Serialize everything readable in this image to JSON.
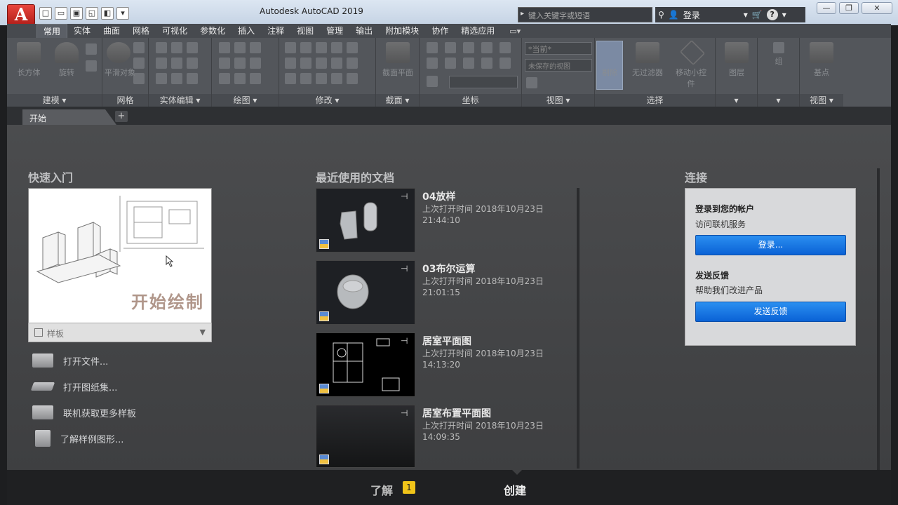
{
  "window": {
    "title": "Autodesk AutoCAD 2019",
    "app_button": "A"
  },
  "search": {
    "placeholder": "键入关键字或短语"
  },
  "topbar": {
    "signin_label": "登录"
  },
  "ribbon_tabs": [
    "常用",
    "实体",
    "曲面",
    "网格",
    "可视化",
    "参数化",
    "插入",
    "注释",
    "视图",
    "管理",
    "输出",
    "附加模块",
    "协作",
    "精选应用"
  ],
  "ribbon_panels": {
    "modeling": {
      "title": "建模",
      "box_label": "长方体",
      "extrude_label": "旋转"
    },
    "mesh": {
      "title": "网格",
      "smooth_label": "平滑对象"
    },
    "solid_edit": {
      "title": "实体编辑"
    },
    "draw": {
      "title": "绘图"
    },
    "modify": {
      "title": "修改"
    },
    "section": {
      "title": "截面",
      "plane_label": "截面平面"
    },
    "coordinates": {
      "title": "坐标"
    },
    "view": {
      "title": "视图",
      "combo1": "*当前*",
      "combo2": "未保存的视图"
    },
    "selection": {
      "title": "选择",
      "culling_label": "剔除",
      "filter_label": "无过滤器",
      "gizmo_label": "移动小控件"
    },
    "layers": {
      "title": "图层"
    },
    "groups": {
      "title": "组"
    },
    "view2": {
      "title": "视图",
      "base_label": "基点"
    }
  },
  "file_tabs": {
    "start": "开始"
  },
  "quick_start": {
    "heading": "快速入门",
    "start_drawing": "开始绘制",
    "template_label": "样板",
    "links": [
      "打开文件...",
      "打开图纸集...",
      "联机获取更多样板",
      "了解样例图形..."
    ]
  },
  "recent": {
    "heading": "最近使用的文档",
    "docs": [
      {
        "name": "04放样",
        "opened": "上次打开时间 2018年10月23日",
        "time": "21:44:10"
      },
      {
        "name": "03布尔运算",
        "opened": "上次打开时间 2018年10月23日",
        "time": "21:01:15"
      },
      {
        "name": "居室平面图",
        "opened": "上次打开时间 2018年10月23日",
        "time": "14:13:20"
      },
      {
        "name": "居室布置平面图",
        "opened": "上次打开时间 2018年10月23日",
        "time": "14:09:35"
      }
    ]
  },
  "connect": {
    "heading": "连接",
    "signin_heading": "登录到您的帐户",
    "signin_sub": "访问联机服务",
    "signin_button": "登录...",
    "feedback_heading": "发送反馈",
    "feedback_sub": "帮助我们改进产品",
    "feedback_button": "发送反馈"
  },
  "bottom": {
    "learn": "了解",
    "learn_badge": "1",
    "create": "创建"
  }
}
